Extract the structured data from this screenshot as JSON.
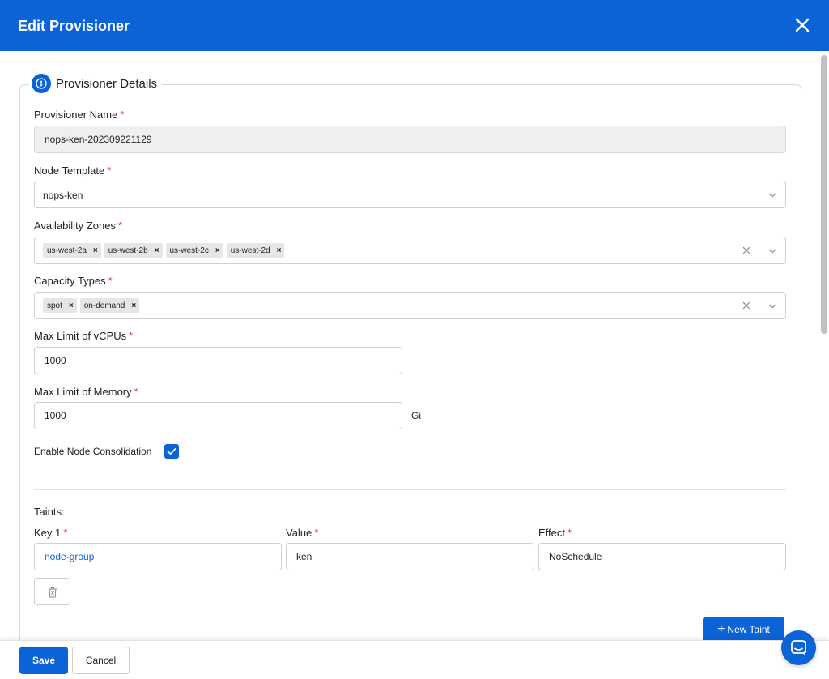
{
  "header": {
    "title": "Edit Provisioner"
  },
  "section": {
    "title": "Provisioner Details"
  },
  "fields": {
    "provisioner_name": {
      "label": "Provisioner Name",
      "required_mark": "*",
      "value": "nops-ken-202309221129"
    },
    "node_template": {
      "label": "Node Template",
      "required_mark": "*",
      "value": "nops-ken"
    },
    "availability_zones": {
      "label": "Availability Zones",
      "required_mark": "*",
      "chips": [
        "us-west-2a",
        "us-west-2b",
        "us-west-2c",
        "us-west-2d"
      ]
    },
    "capacity_types": {
      "label": "Capacity Types",
      "required_mark": "*",
      "chips": [
        "spot",
        "on-demand"
      ]
    },
    "max_vcpus": {
      "label": "Max Limit of vCPUs",
      "required_mark": "*",
      "value": "1000"
    },
    "max_memory": {
      "label": "Max Limit of Memory",
      "required_mark": "*",
      "value": "1000",
      "unit": "Gi"
    },
    "consolidation": {
      "label": "Enable Node Consolidation",
      "checked": true
    }
  },
  "taints": {
    "title": "Taints:",
    "columns": {
      "key": "Key 1",
      "value": "Value",
      "effect": "Effect"
    },
    "required_mark": "*",
    "rows": [
      {
        "key": "node-group",
        "value": "ken",
        "effect": "NoSchedule"
      }
    ],
    "new_label": "New Taint",
    "new_icon": "+"
  },
  "chip_remove": "×",
  "footer": {
    "save_label": "Save",
    "cancel_label": "Cancel"
  },
  "colors": {
    "primary": "#0b63d8",
    "required": "#e0334c"
  },
  "icons": {
    "close": "close-icon",
    "legend": "info-badge-icon",
    "trash": "trash-icon",
    "chat": "chat-icon",
    "check": "check-icon",
    "chevron": "chevron-down-icon"
  }
}
